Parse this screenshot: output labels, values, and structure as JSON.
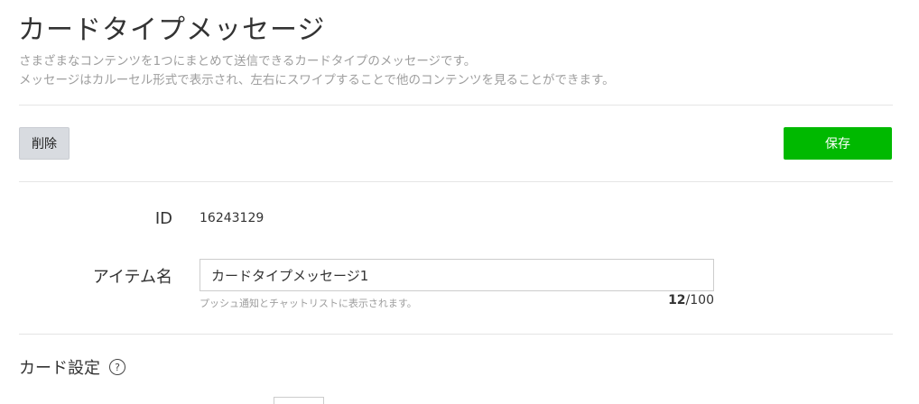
{
  "header": {
    "title": "カードタイプメッセージ",
    "description_line1": "さまざまなコンテンツを1つにまとめて送信できるカードタイプのメッセージです。",
    "description_line2": "メッセージはカルーセル形式で表示され、左右にスワイプすることで他のコンテンツを見ることができます。"
  },
  "toolbar": {
    "delete_label": "削除",
    "save_label": "保存"
  },
  "form": {
    "id_label": "ID",
    "id_value": "16243129",
    "item_name_label": "アイテム名",
    "item_name_value": "カードタイプメッセージ1",
    "item_name_hint": "プッシュ通知とチャットリストに表示されます。",
    "char_count_current": "12",
    "char_count_max": "/100"
  },
  "card_settings": {
    "title": "カード設定",
    "help_glyph": "?"
  },
  "colors": {
    "accent": "#00b900",
    "delete_bg": "#d8dbe0"
  }
}
